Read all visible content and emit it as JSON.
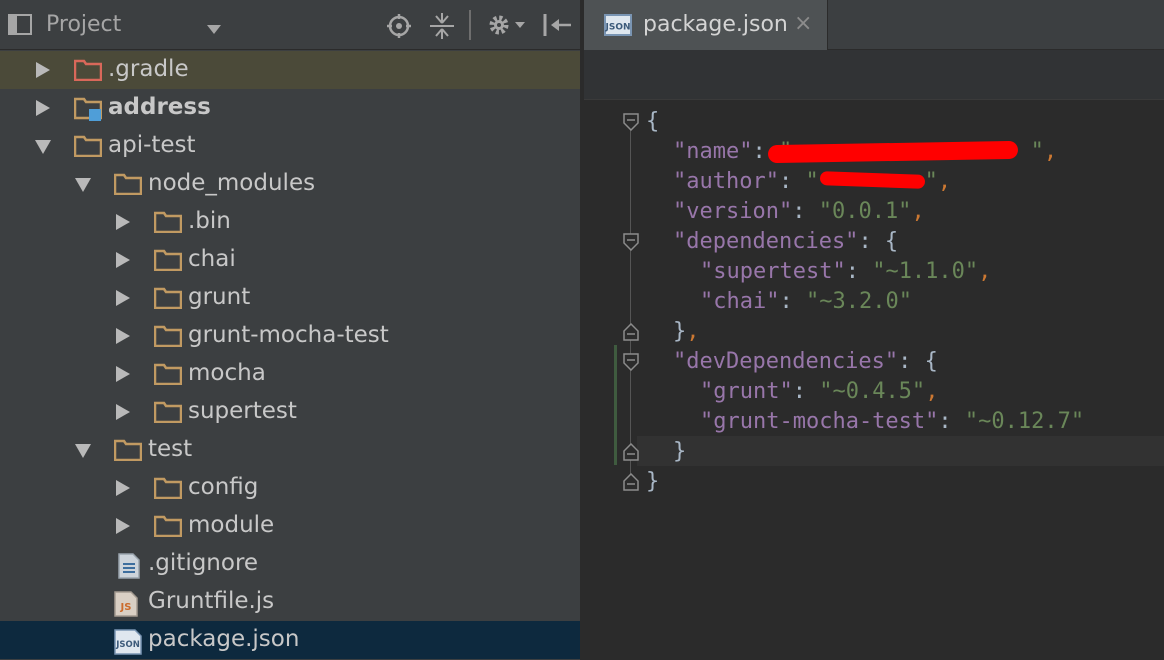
{
  "panel": {
    "title": "Project"
  },
  "tree": [
    {
      "label": ".gradle",
      "arrow": "right",
      "icon": "folder-icon",
      "bold": false
    },
    {
      "label": "address",
      "arrow": "right",
      "icon": "module-folder-icon",
      "bold": true
    },
    {
      "label": "api-test",
      "arrow": "down",
      "icon": "folder-icon",
      "bold": false
    },
    {
      "label": "node_modules",
      "arrow": "down",
      "icon": "folder-icon",
      "bold": false
    },
    {
      "label": ".bin",
      "arrow": "right",
      "icon": "folder-icon",
      "bold": false
    },
    {
      "label": "chai",
      "arrow": "right",
      "icon": "folder-icon",
      "bold": false
    },
    {
      "label": "grunt",
      "arrow": "right",
      "icon": "folder-icon",
      "bold": false
    },
    {
      "label": "grunt-mocha-test",
      "arrow": "right",
      "icon": "folder-icon",
      "bold": false
    },
    {
      "label": "mocha",
      "arrow": "right",
      "icon": "folder-icon",
      "bold": false
    },
    {
      "label": "supertest",
      "arrow": "right",
      "icon": "folder-icon",
      "bold": false
    },
    {
      "label": "test",
      "arrow": "down",
      "icon": "folder-icon",
      "bold": false
    },
    {
      "label": "config",
      "arrow": "right",
      "icon": "folder-icon",
      "bold": false
    },
    {
      "label": "module",
      "arrow": "right",
      "icon": "folder-icon",
      "bold": false
    },
    {
      "label": ".gitignore",
      "arrow": "",
      "icon": "text-file-icon",
      "bold": false
    },
    {
      "label": "Gruntfile.js",
      "arrow": "",
      "icon": "js-file-icon",
      "bold": false
    },
    {
      "label": "package.json",
      "arrow": "",
      "icon": "json-file-icon",
      "bold": false
    }
  ],
  "editor": {
    "tab_label": "package.json",
    "tab_close": "×",
    "lines": [
      {
        "indent": 0,
        "parts": [
          [
            "b",
            "{"
          ]
        ]
      },
      {
        "indent": 1,
        "parts": [
          [
            "k",
            "\"name\""
          ],
          [
            "b",
            ":"
          ],
          [
            "s",
            " \"                  \""
          ],
          [
            "p",
            ","
          ]
        ]
      },
      {
        "indent": 1,
        "parts": [
          [
            "k",
            "\"author\""
          ],
          [
            "b",
            ":"
          ],
          [
            "s",
            " \"        \""
          ],
          [
            "p",
            ","
          ]
        ]
      },
      {
        "indent": 1,
        "parts": [
          [
            "k",
            "\"version\""
          ],
          [
            "b",
            ":"
          ],
          [
            "s",
            " \"0.0.1\""
          ],
          [
            "p",
            ","
          ]
        ]
      },
      {
        "indent": 1,
        "parts": [
          [
            "k",
            "\"dependencies\""
          ],
          [
            "b",
            ": {"
          ]
        ]
      },
      {
        "indent": 2,
        "parts": [
          [
            "k",
            "\"supertest\""
          ],
          [
            "b",
            ":"
          ],
          [
            "s",
            " \"~1.1.0\""
          ],
          [
            "p",
            ","
          ]
        ]
      },
      {
        "indent": 2,
        "parts": [
          [
            "k",
            "\"chai\""
          ],
          [
            "b",
            ":"
          ],
          [
            "s",
            " \"~3.2.0\""
          ]
        ]
      },
      {
        "indent": 1,
        "parts": [
          [
            "b",
            "}"
          ],
          [
            "p",
            ","
          ]
        ]
      },
      {
        "indent": 1,
        "parts": [
          [
            "k",
            "\"devDependencies\""
          ],
          [
            "b",
            ": {"
          ]
        ]
      },
      {
        "indent": 2,
        "parts": [
          [
            "k",
            "\"grunt\""
          ],
          [
            "b",
            ":"
          ],
          [
            "s",
            " \"~0.4.5\""
          ],
          [
            "p",
            ","
          ]
        ]
      },
      {
        "indent": 2,
        "parts": [
          [
            "k",
            "\"grunt-mocha-test\""
          ],
          [
            "b",
            ":"
          ],
          [
            "s",
            " \"~0.12.7\""
          ]
        ]
      },
      {
        "indent": 1,
        "parts": [
          [
            "b",
            "}"
          ]
        ]
      },
      {
        "indent": 0,
        "parts": [
          [
            "b",
            "}"
          ]
        ]
      }
    ]
  },
  "colors": {
    "panel_bg": "#3c3f41",
    "editor_bg": "#2b2b2b",
    "selection_bg": "#0d293e",
    "key": "#9876aa",
    "string": "#6a8759",
    "punct": "#cc7832",
    "folder": "#c19a62",
    "redaction": "#ff0000"
  }
}
